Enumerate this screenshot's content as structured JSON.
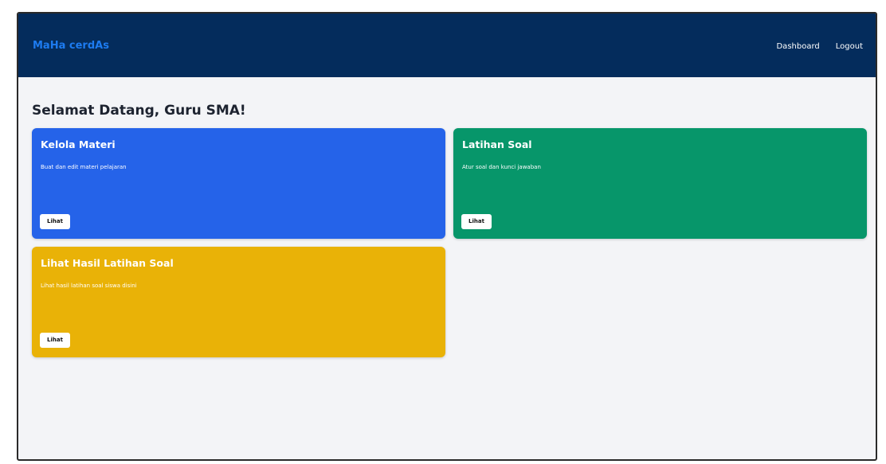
{
  "navbar": {
    "brand": "MaHa cerdAs",
    "links": [
      "Dashboard",
      "Logout"
    ]
  },
  "main": {
    "title": "Selamat Datang, Guru SMA!",
    "cards": [
      {
        "title": "Kelola Materi",
        "description": "Buat dan edit materi pelajaran",
        "button_label": "Lihat",
        "color": "#2563e9"
      },
      {
        "title": "Latihan Soal",
        "description": "Atur soal dan kunci jawaban",
        "button_label": "Lihat",
        "color": "#07966a"
      },
      {
        "title": "Lihat Hasil Latihan Soal",
        "description": "Lihat hasil latihan soal siswa disini",
        "button_label": "Lihat",
        "color": "#e9b207"
      }
    ]
  },
  "colors": {
    "navbar_bg": "#042c5c",
    "brand": "#1d7bf0",
    "page_bg": "#f3f4f7"
  }
}
